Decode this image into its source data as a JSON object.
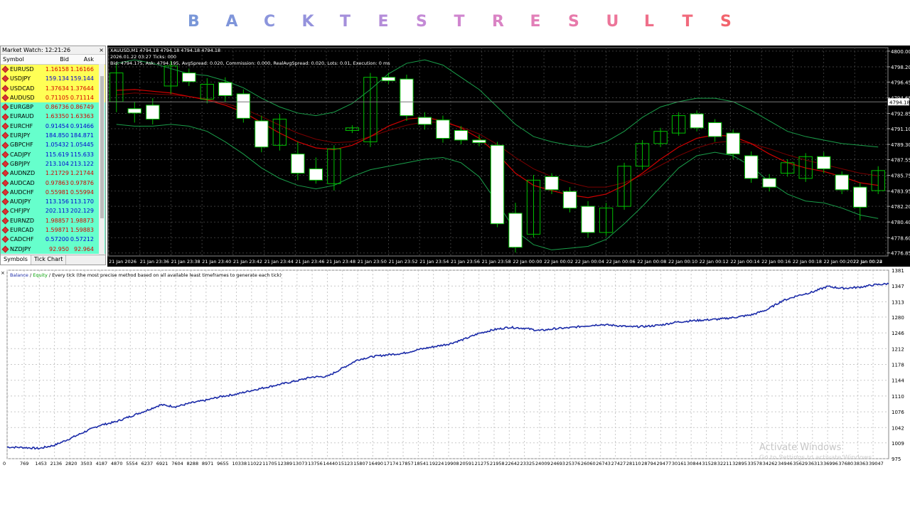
{
  "title": {
    "letters": [
      {
        "ch": "B",
        "color": "#7a97d8"
      },
      {
        "ch": "A",
        "color": "#7f95da"
      },
      {
        "ch": "C",
        "color": "#8c95dc"
      },
      {
        "ch": "K",
        "color": "#9492dc"
      },
      {
        "ch": "T",
        "color": "#a48fdb"
      },
      {
        "ch": "E",
        "color": "#b48cd9"
      },
      {
        "ch": "S",
        "color": "#c48ad6"
      },
      {
        "ch": "T",
        "color": "#d086cf"
      },
      {
        "ch": "R",
        "color": "#da83c4"
      },
      {
        "ch": "E",
        "color": "#e27fb8"
      },
      {
        "ch": "S",
        "color": "#e77aab"
      },
      {
        "ch": "U",
        "color": "#ec7599"
      },
      {
        "ch": "L",
        "color": "#ef6f8a"
      },
      {
        "ch": "T",
        "color": "#f16a7c"
      },
      {
        "ch": "S",
        "color": "#f2646d"
      }
    ]
  },
  "market_watch": {
    "title": "Market Watch: 12:21:26",
    "close": "×",
    "columns": {
      "symbol": "Symbol",
      "bid": "Bid",
      "ask": "Ask"
    },
    "rows": [
      {
        "symbol": "EURUSD",
        "bid": "1.16158",
        "ask": "1.16166",
        "bg": "#ffff55",
        "color": "#d40000"
      },
      {
        "symbol": "USDJPY",
        "bid": "159.134",
        "ask": "159.144",
        "bg": "#ffff55",
        "color": "#0000d0"
      },
      {
        "symbol": "USDCAD",
        "bid": "1.37634",
        "ask": "1.37644",
        "bg": "#ffff55",
        "color": "#d40000"
      },
      {
        "symbol": "AUDUSD",
        "bid": "0.71105",
        "ask": "0.71114",
        "bg": "#ffff55",
        "color": "#d40000"
      },
      {
        "symbol": "EURGBP",
        "bid": "0.86736",
        "ask": "0.86749",
        "bg": "#66ffcc",
        "color": "#d40000"
      },
      {
        "symbol": "EURAUD",
        "bid": "1.63350",
        "ask": "1.63363",
        "bg": "#66ffcc",
        "color": "#d40000"
      },
      {
        "symbol": "EURCHF",
        "bid": "0.91454",
        "ask": "0.91466",
        "bg": "#66ffcc",
        "color": "#0000d0"
      },
      {
        "symbol": "EURJPY",
        "bid": "184.850",
        "ask": "184.871",
        "bg": "#66ffcc",
        "color": "#0000d0"
      },
      {
        "symbol": "GBPCHF",
        "bid": "1.05432",
        "ask": "1.05445",
        "bg": "#66ffcc",
        "color": "#0000d0"
      },
      {
        "symbol": "CADJPY",
        "bid": "115.619",
        "ask": "115.633",
        "bg": "#66ffcc",
        "color": "#0000d0"
      },
      {
        "symbol": "GBPJPY",
        "bid": "213.104",
        "ask": "213.122",
        "bg": "#66ffcc",
        "color": "#0000d0"
      },
      {
        "symbol": "AUDNZD",
        "bid": "1.21729",
        "ask": "1.21744",
        "bg": "#66ffcc",
        "color": "#d40000"
      },
      {
        "symbol": "AUDCAD",
        "bid": "0.97863",
        "ask": "0.97876",
        "bg": "#66ffcc",
        "color": "#d40000"
      },
      {
        "symbol": "AUDCHF",
        "bid": "0.55981",
        "ask": "0.55994",
        "bg": "#66ffcc",
        "color": "#d40000"
      },
      {
        "symbol": "AUDJPY",
        "bid": "113.156",
        "ask": "113.170",
        "bg": "#66ffcc",
        "color": "#0000d0"
      },
      {
        "symbol": "CHFJPY",
        "bid": "202.113",
        "ask": "202.129",
        "bg": "#66ffcc",
        "color": "#0000d0"
      },
      {
        "symbol": "EURNZD",
        "bid": "1.98857",
        "ask": "1.98873",
        "bg": "#66ffcc",
        "color": "#d40000"
      },
      {
        "symbol": "EURCAD",
        "bid": "1.59871",
        "ask": "1.59883",
        "bg": "#66ffcc",
        "color": "#d40000"
      },
      {
        "symbol": "CADCHF",
        "bid": "0.57200",
        "ask": "0.57212",
        "bg": "#66ffcc",
        "color": "#0000d0"
      },
      {
        "symbol": "NZDJPY",
        "bid": "92.950",
        "ask": "92.964",
        "bg": "#66ffcc",
        "color": "#d40000"
      }
    ],
    "tabs": [
      "Symbols",
      "Tick Chart"
    ]
  },
  "price_chart": {
    "header_line1": "XAUUSD,M1  4794.18 4794.18 4794.18 4794.18",
    "header_line2": "2026.01.22 03:27  Ticks: 000",
    "header_line3": "Bid: 4794.175, Ask: 4794.195, AvgSpread: 0.020, Commission: 0.000, RealAvgSpread: 0.020, Lots: 0.01, Execution: 0 ms",
    "price_labels": [
      "4800.00",
      "4798.20",
      "4796.45",
      "4794.65",
      "4792.85",
      "4791.10",
      "4789.30",
      "4787.55",
      "4785.75",
      "4783.95",
      "4782.20",
      "4780.40",
      "4778.60",
      "4776.85"
    ],
    "current_price": "4794.18",
    "time_labels": [
      "21 Jan 2026",
      "21 Jan 23:36",
      "21 Jan 23:38",
      "21 Jan 23:40",
      "21 Jan 23:42",
      "21 Jan 23:44",
      "21 Jan 23:46",
      "21 Jan 23:48",
      "21 Jan 23:50",
      "21 Jan 23:52",
      "21 Jan 23:54",
      "21 Jan 23:56",
      "21 Jan 23:58",
      "22 Jan 00:00",
      "22 Jan 00:02",
      "22 Jan 00:04",
      "22 Jan 00:06",
      "22 Jan 00:08",
      "22 Jan 00:10",
      "22 Jan 00:12",
      "22 Jan 00:14",
      "22 Jan 00:16",
      "22 Jan 00:18",
      "22 Jan 00:20",
      "22 Jan 00:22",
      "22 Jan 00:24"
    ],
    "colors": {
      "up": "#00c000",
      "down_fill": "#ffffff",
      "ma_red": "#d00000",
      "band_green": "#1a9e4a",
      "grid": "#3a3a3a",
      "axis_text": "#ffffff"
    },
    "candles": [
      {
        "t": 0,
        "o": 4794.2,
        "c": 4797.5,
        "h": 4798.6,
        "l": 4793.0
      },
      {
        "t": 1,
        "o": 4793.4,
        "c": 4792.9,
        "h": 4794.2,
        "l": 4791.8
      },
      {
        "t": 2,
        "o": 4793.8,
        "c": 4792.2,
        "h": 4794.6,
        "l": 4791.6
      },
      {
        "t": 3,
        "o": 4796.0,
        "c": 4798.3,
        "h": 4798.9,
        "l": 4795.1
      },
      {
        "t": 4,
        "o": 4797.5,
        "c": 4796.5,
        "h": 4798.0,
        "l": 4796.0
      },
      {
        "t": 5,
        "o": 4794.5,
        "c": 4796.2,
        "h": 4796.9,
        "l": 4794.0
      },
      {
        "t": 6,
        "o": 4796.4,
        "c": 4794.9,
        "h": 4797.0,
        "l": 4794.2
      },
      {
        "t": 7,
        "o": 4795.1,
        "c": 4792.3,
        "h": 4795.6,
        "l": 4791.8
      },
      {
        "t": 8,
        "o": 4792.0,
        "c": 4789.0,
        "h": 4792.6,
        "l": 4788.4
      },
      {
        "t": 9,
        "o": 4789.2,
        "c": 4792.2,
        "h": 4792.8,
        "l": 4788.6
      },
      {
        "t": 10,
        "o": 4788.2,
        "c": 4786.0,
        "h": 4789.6,
        "l": 4785.2
      },
      {
        "t": 11,
        "o": 4786.5,
        "c": 4785.2,
        "h": 4787.8,
        "l": 4784.8
      },
      {
        "t": 12,
        "o": 4784.8,
        "c": 4788.8,
        "h": 4789.2,
        "l": 4784.0
      },
      {
        "t": 13,
        "o": 4790.9,
        "c": 4791.2,
        "h": 4791.5,
        "l": 4790.6
      },
      {
        "t": 14,
        "o": 4789.6,
        "c": 4797.0,
        "h": 4797.5,
        "l": 4789.0
      },
      {
        "t": 15,
        "o": 4797.0,
        "c": 4796.6,
        "h": 4797.5,
        "l": 4796.2
      },
      {
        "t": 16,
        "o": 4796.8,
        "c": 4792.6,
        "h": 4797.3,
        "l": 4792.0
      },
      {
        "t": 17,
        "o": 4792.4,
        "c": 4791.6,
        "h": 4793.0,
        "l": 4791.0
      },
      {
        "t": 18,
        "o": 4792.1,
        "c": 4790.0,
        "h": 4792.6,
        "l": 4789.5
      },
      {
        "t": 19,
        "o": 4790.9,
        "c": 4789.8,
        "h": 4791.4,
        "l": 4789.3
      },
      {
        "t": 20,
        "o": 4789.8,
        "c": 4789.5,
        "h": 4790.4,
        "l": 4789.1
      },
      {
        "t": 21,
        "o": 4789.2,
        "c": 4780.2,
        "h": 4789.6,
        "l": 4779.8
      },
      {
        "t": 22,
        "o": 4781.4,
        "c": 4777.5,
        "h": 4782.6,
        "l": 4776.9
      },
      {
        "t": 23,
        "o": 4779.0,
        "c": 4785.2,
        "h": 4785.8,
        "l": 4778.6
      },
      {
        "t": 24,
        "o": 4785.6,
        "c": 4784.1,
        "h": 4786.0,
        "l": 4783.6
      },
      {
        "t": 25,
        "o": 4783.9,
        "c": 4782.0,
        "h": 4784.4,
        "l": 4781.5
      },
      {
        "t": 26,
        "o": 4782.2,
        "c": 4779.2,
        "h": 4782.8,
        "l": 4778.6
      },
      {
        "t": 27,
        "o": 4779.2,
        "c": 4782.0,
        "h": 4782.6,
        "l": 4778.8
      },
      {
        "t": 28,
        "o": 4782.2,
        "c": 4786.8,
        "h": 4787.2,
        "l": 4781.8
      },
      {
        "t": 29,
        "o": 4786.8,
        "c": 4789.4,
        "h": 4789.8,
        "l": 4786.4
      },
      {
        "t": 30,
        "o": 4789.4,
        "c": 4790.8,
        "h": 4791.2,
        "l": 4789.0
      },
      {
        "t": 31,
        "o": 4790.6,
        "c": 4792.6,
        "h": 4793.0,
        "l": 4790.3
      },
      {
        "t": 32,
        "o": 4792.8,
        "c": 4791.2,
        "h": 4793.2,
        "l": 4790.8
      },
      {
        "t": 33,
        "o": 4791.8,
        "c": 4790.2,
        "h": 4792.2,
        "l": 4789.6
      },
      {
        "t": 34,
        "o": 4790.6,
        "c": 4788.2,
        "h": 4791.0,
        "l": 4787.6
      },
      {
        "t": 35,
        "o": 4788.0,
        "c": 4785.4,
        "h": 4788.5,
        "l": 4784.9
      },
      {
        "t": 36,
        "o": 4785.4,
        "c": 4784.4,
        "h": 4785.9,
        "l": 4783.9
      },
      {
        "t": 37,
        "o": 4786.0,
        "c": 4787.2,
        "h": 4787.6,
        "l": 4785.6
      },
      {
        "t": 38,
        "o": 4785.4,
        "c": 4787.9,
        "h": 4788.3,
        "l": 4785.0
      },
      {
        "t": 39,
        "o": 4787.9,
        "c": 4786.5,
        "h": 4788.4,
        "l": 4786.0
      },
      {
        "t": 40,
        "o": 4785.8,
        "c": 4784.1,
        "h": 4786.2,
        "l": 4783.6
      },
      {
        "t": 41,
        "o": 4784.4,
        "c": 4782.1,
        "h": 4784.9,
        "l": 4780.6
      },
      {
        "t": 42,
        "o": 4784.0,
        "c": 4786.3,
        "h": 4786.8,
        "l": 4783.6
      }
    ],
    "ma_red": [
      4795.5,
      4795.6,
      4795.4,
      4795.2,
      4794.8,
      4794.4,
      4793.8,
      4793.0,
      4791.8,
      4790.6,
      4789.6,
      4788.9,
      4788.7,
      4789.2,
      4790.2,
      4791.4,
      4792.2,
      4792.4,
      4792.0,
      4791.2,
      4790.0,
      4788.2,
      4786.0,
      4784.6,
      4784.0,
      4783.5,
      4783.2,
      4783.6,
      4784.6,
      4786.0,
      4787.6,
      4789.0,
      4790.0,
      4790.4,
      4790.2,
      4789.4,
      4788.2,
      4787.2,
      4786.6,
      4786.2,
      4785.6,
      4784.9,
      4784.6
    ],
    "ma_dark_red": [
      4795.0,
      4795.2,
      4795.1,
      4795.0,
      4794.8,
      4794.5,
      4794.0,
      4793.4,
      4792.5,
      4791.5,
      4790.6,
      4789.9,
      4789.5,
      4789.6,
      4790.2,
      4790.9,
      4791.5,
      4791.9,
      4791.8,
      4791.3,
      4790.5,
      4789.3,
      4787.8,
      4786.5,
      4785.6,
      4784.9,
      4784.4,
      4784.4,
      4784.9,
      4785.8,
      4786.9,
      4788.0,
      4788.9,
      4789.5,
      4789.7,
      4789.4,
      4788.8,
      4788.1,
      4787.5,
      4787.0,
      4786.5,
      4786.0,
      4785.7
    ],
    "band_upper": [
      4798.6,
      4799.0,
      4798.6,
      4798.0,
      4797.4,
      4797.2,
      4796.6,
      4795.8,
      4794.6,
      4793.6,
      4792.9,
      4792.6,
      4793.0,
      4794.0,
      4795.6,
      4797.4,
      4798.6,
      4799.0,
      4798.4,
      4797.0,
      4795.6,
      4793.6,
      4791.6,
      4790.2,
      4789.6,
      4789.2,
      4789.0,
      4789.6,
      4790.8,
      4792.4,
      4793.6,
      4794.2,
      4794.6,
      4794.6,
      4794.2,
      4793.2,
      4792.0,
      4790.8,
      4790.2,
      4789.8,
      4789.4,
      4789.2,
      4789.0
    ],
    "band_lower": [
      4791.6,
      4791.4,
      4791.4,
      4791.6,
      4791.4,
      4790.8,
      4789.6,
      4788.2,
      4786.6,
      4785.4,
      4784.6,
      4784.2,
      4784.6,
      4785.6,
      4786.4,
      4786.8,
      4787.2,
      4787.6,
      4787.8,
      4787.2,
      4785.6,
      4782.6,
      4779.4,
      4777.8,
      4777.2,
      4777.4,
      4777.6,
      4778.4,
      4780.2,
      4782.2,
      4784.4,
      4786.6,
      4788.0,
      4788.4,
      4788.0,
      4786.8,
      4785.0,
      4783.6,
      4782.8,
      4782.6,
      4782.0,
      4781.2,
      4780.8
    ]
  },
  "equity_chart": {
    "legend": {
      "balance": "Balance",
      "sep1": " / ",
      "equity": "Equity",
      "sep2": " / ",
      "rest": "Every tick (the most precise method based on all available least timeframes to generate each tick)"
    },
    "y_labels": [
      "1381",
      "1347",
      "1313",
      "1280",
      "1246",
      "1212",
      "1178",
      "1144",
      "1110",
      "1076",
      "1042",
      "1009",
      "975"
    ],
    "x_labels": [
      "0",
      "769",
      "1453",
      "2136",
      "2820",
      "3503",
      "4187",
      "4870",
      "5554",
      "6237",
      "6921",
      "7604",
      "8288",
      "8971",
      "9655",
      "10338",
      "11022",
      "11705",
      "12389",
      "13073",
      "13756",
      "14440",
      "15123",
      "15807",
      "16490",
      "17174",
      "17857",
      "18541",
      "19224",
      "19908",
      "20591",
      "21275",
      "21958",
      "22642",
      "23325",
      "24009",
      "24693",
      "25376",
      "26060",
      "26743",
      "27427",
      "28110",
      "28794",
      "29477",
      "30161",
      "30844",
      "31528",
      "32211",
      "32895",
      "33578",
      "34262",
      "34946",
      "35629",
      "36313",
      "36996",
      "37680",
      "38363",
      "39047"
    ],
    "colors": {
      "balance": "#1a2aa8",
      "equity": "#00a000",
      "grid": "#c8c8c8"
    },
    "ylim": [
      975,
      1381
    ],
    "xlim": [
      0,
      39750
    ],
    "balance_points": [
      [
        0,
        1000
      ],
      [
        769,
        999
      ],
      [
        1453,
        997
      ],
      [
        2136,
        1004
      ],
      [
        2820,
        1018
      ],
      [
        3503,
        1033
      ],
      [
        4187,
        1047
      ],
      [
        4870,
        1054
      ],
      [
        5554,
        1066
      ],
      [
        6237,
        1078
      ],
      [
        6921,
        1091
      ],
      [
        7604,
        1087
      ],
      [
        8288,
        1095
      ],
      [
        8971,
        1101
      ],
      [
        9655,
        1109
      ],
      [
        10338,
        1114
      ],
      [
        11022,
        1122
      ],
      [
        11705,
        1129
      ],
      [
        12389,
        1136
      ],
      [
        13073,
        1143
      ],
      [
        13756,
        1151
      ],
      [
        14440,
        1152
      ],
      [
        15123,
        1170
      ],
      [
        15807,
        1188
      ],
      [
        16490,
        1195
      ],
      [
        17174,
        1199
      ],
      [
        17857,
        1202
      ],
      [
        18541,
        1210
      ],
      [
        19224,
        1216
      ],
      [
        19908,
        1222
      ],
      [
        20591,
        1232
      ],
      [
        21275,
        1245
      ],
      [
        21958,
        1253
      ],
      [
        22642,
        1258
      ],
      [
        23325,
        1256
      ],
      [
        24009,
        1251
      ],
      [
        24693,
        1255
      ],
      [
        25376,
        1257
      ],
      [
        26060,
        1261
      ],
      [
        26743,
        1264
      ],
      [
        27427,
        1262
      ],
      [
        28110,
        1259
      ],
      [
        28794,
        1260
      ],
      [
        29477,
        1263
      ],
      [
        30161,
        1269
      ],
      [
        30844,
        1272
      ],
      [
        31528,
        1274
      ],
      [
        32211,
        1276
      ],
      [
        32895,
        1280
      ],
      [
        33578,
        1285
      ],
      [
        34262,
        1296
      ],
      [
        34946,
        1315
      ],
      [
        35629,
        1326
      ],
      [
        36313,
        1334
      ],
      [
        36996,
        1346
      ],
      [
        37680,
        1342
      ],
      [
        38363,
        1344
      ],
      [
        39047,
        1349
      ],
      [
        39750,
        1352
      ]
    ]
  },
  "watermark": {
    "line1": "Activate Windows",
    "line2": "Go to Settings to activate Windows."
  }
}
